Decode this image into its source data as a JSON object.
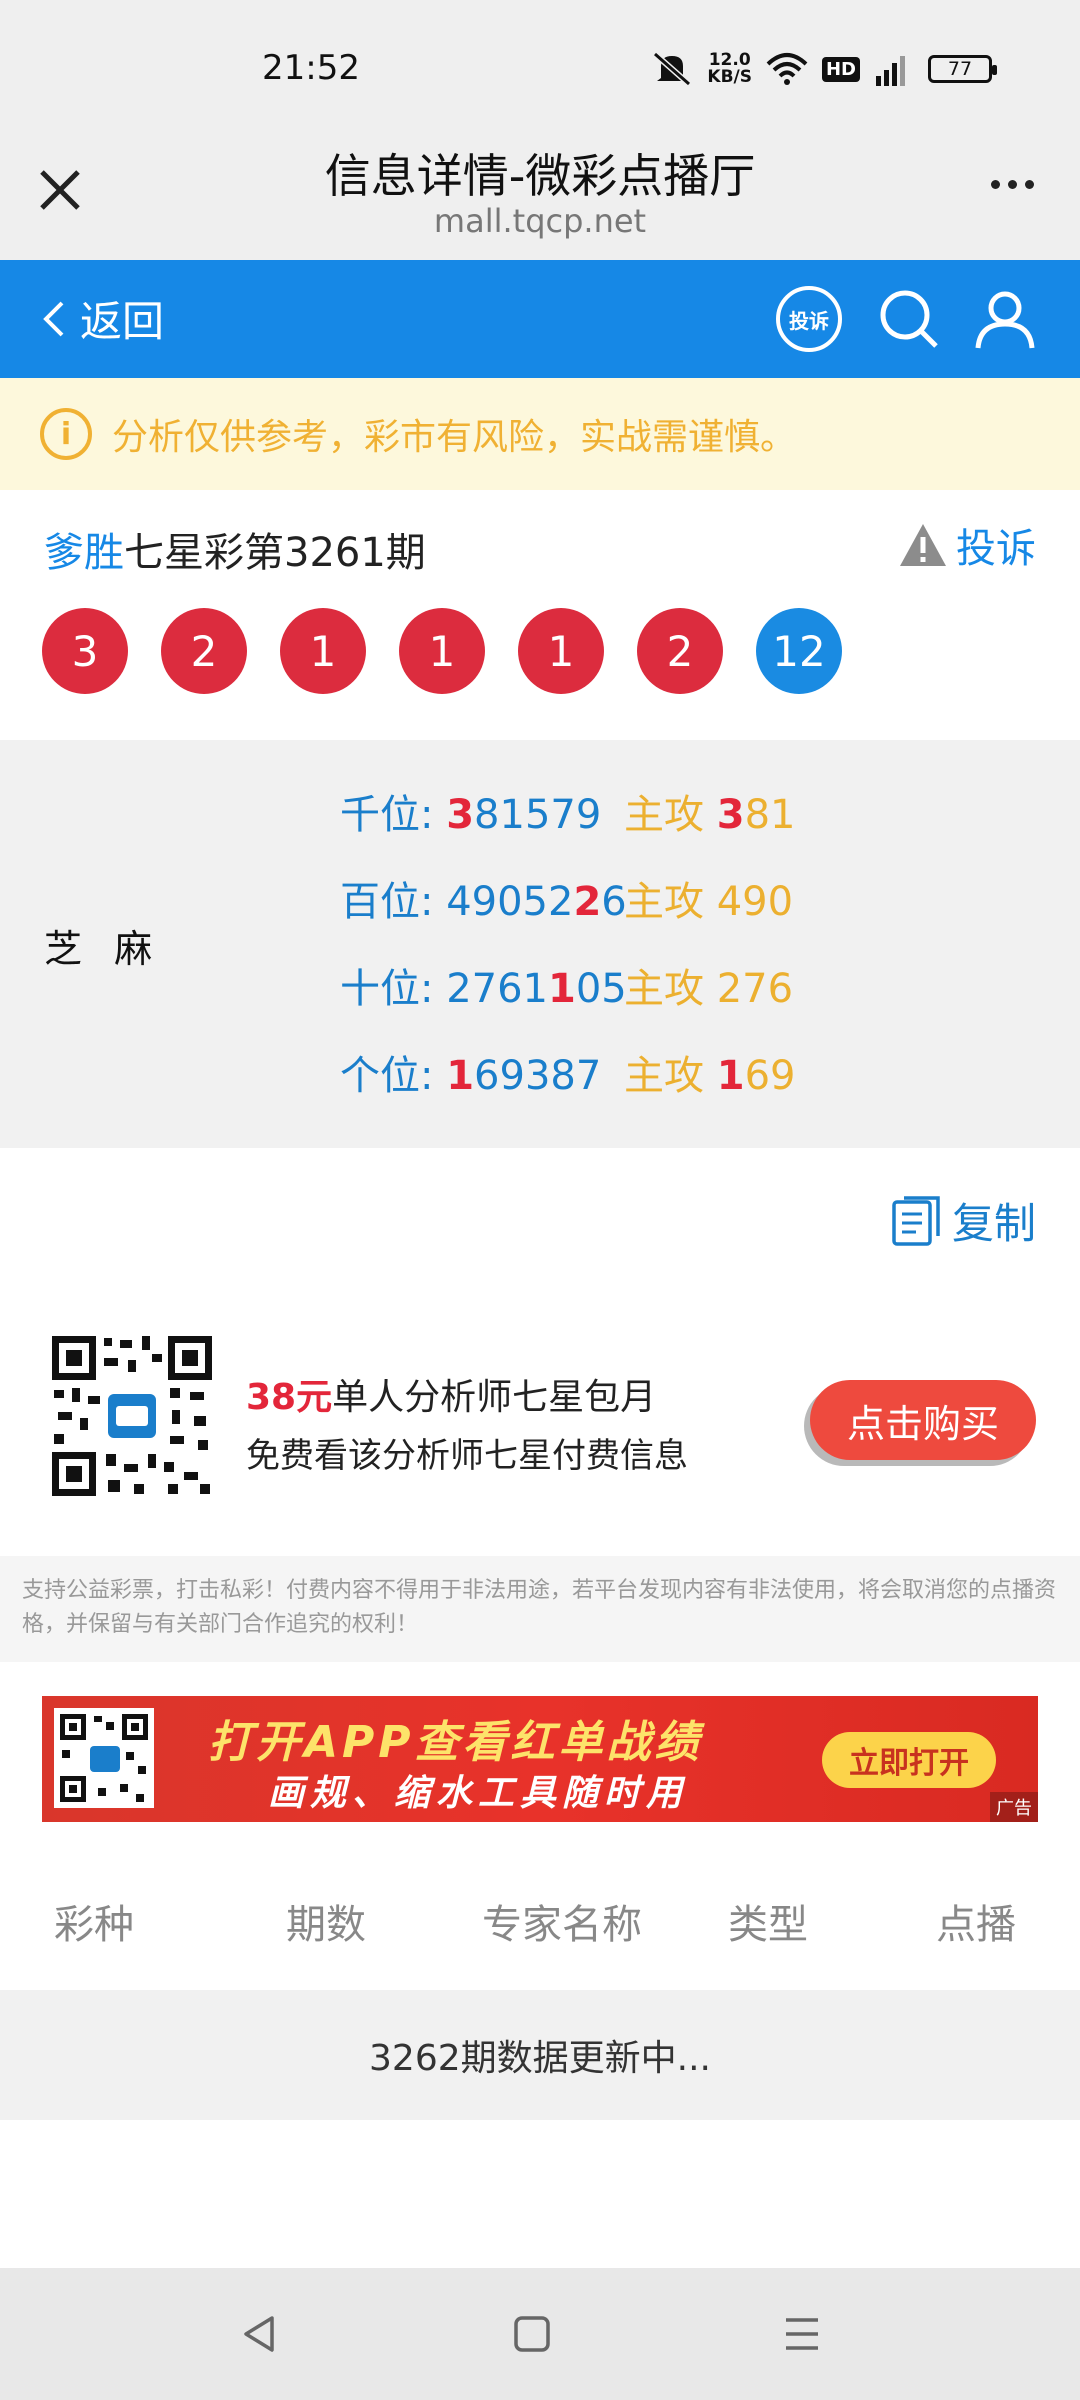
{
  "status_bar": {
    "time": "21:52",
    "net_speed_value": "12.0",
    "net_speed_unit": "KB/S",
    "hd": "HD",
    "network": "4G",
    "battery": "77"
  },
  "browser": {
    "title": "信息详情-微彩点播厅",
    "url": "mall.tqcp.net"
  },
  "nav": {
    "back_label": "返回",
    "complain_icon_text": "投诉"
  },
  "notice": {
    "text": "分析仅供参考，彩市有风险，实战需谨慎。"
  },
  "issue": {
    "author": "爹胜",
    "title": "七星彩第3261期",
    "report_label": "投诉",
    "balls": [
      {
        "value": "3",
        "color": "#dc2c3e"
      },
      {
        "value": "2",
        "color": "#dc2c3e"
      },
      {
        "value": "1",
        "color": "#dc2c3e"
      },
      {
        "value": "1",
        "color": "#dc2c3e"
      },
      {
        "value": "1",
        "color": "#dc2c3e"
      },
      {
        "value": "2",
        "color": "#dc2c3e"
      },
      {
        "value": "12",
        "color": "#1a8be2"
      }
    ]
  },
  "analysis": {
    "analyst": "芝 麻",
    "lines": [
      {
        "pos_label": "千位: ",
        "pos_pre": "",
        "pos_hit": "3",
        "pos_post": "81579",
        "main_label": "主攻 ",
        "main_pre": "",
        "main_hit": "3",
        "main_post": "81"
      },
      {
        "pos_label": "百位: ",
        "pos_pre": "49052",
        "pos_hit": "2",
        "pos_post": "6",
        "main_label": "主攻 ",
        "main_pre": "490",
        "main_hit": "",
        "main_post": ""
      },
      {
        "pos_label": "十位: ",
        "pos_pre": "2761",
        "pos_hit": "1",
        "pos_post": "05",
        "main_label": "主攻 ",
        "main_pre": "276",
        "main_hit": "",
        "main_post": ""
      },
      {
        "pos_label": "个位: ",
        "pos_pre": "",
        "pos_hit": "1",
        "pos_post": "69387",
        "main_label": "主攻 ",
        "main_pre": "",
        "main_hit": "1",
        "main_post": "69"
      }
    ],
    "copy_label": "复制"
  },
  "promo": {
    "price": "38元",
    "line1": "单人分析师七星包月",
    "line2": "免费看该分析师七星付费信息",
    "buy_label": "点击购买"
  },
  "disclaimer": "支持公益彩票，打击私彩！付费内容不得用于非法用途，若平台发现内容有非法使用，将会取消您的点播资格，并保留与有关部门合作追究的权利！",
  "banner": {
    "title": "打开APP查看红单战绩",
    "subtitle": "画规、缩水工具随时用",
    "button": "立即打开",
    "ad_tag": "广告"
  },
  "table": {
    "headers": [
      "彩种",
      "期数",
      "专家名称",
      "类型",
      "点播"
    ],
    "update_text": "3262期数据更新中..."
  }
}
